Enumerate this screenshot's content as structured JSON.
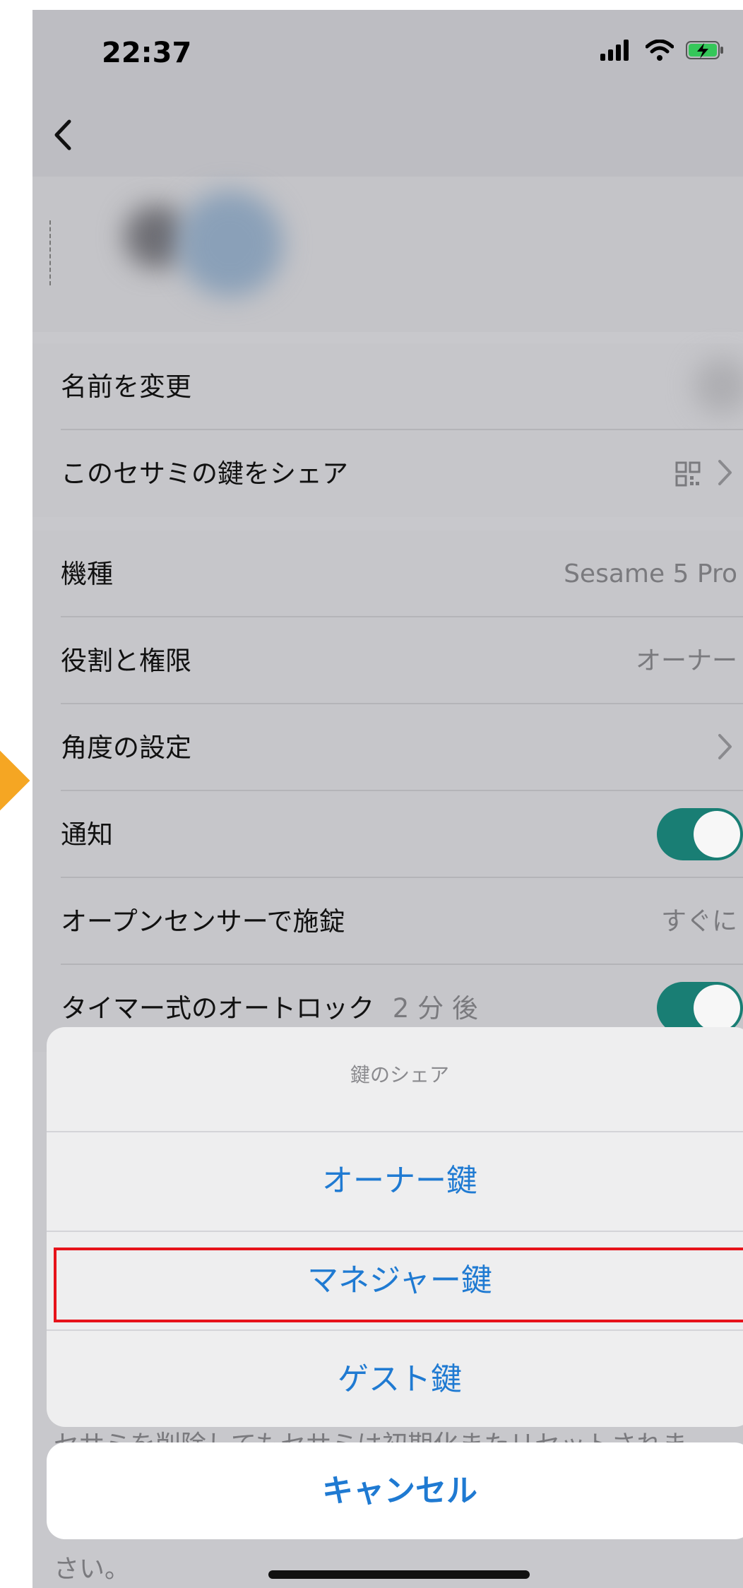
{
  "status_bar": {
    "time": "22:37",
    "icons": [
      "signal-icon",
      "wifi-icon",
      "battery-charging-icon"
    ]
  },
  "nav": {
    "back_icon": "chevron-left-icon"
  },
  "sections": {
    "group1": [
      {
        "label": "名前を変更"
      },
      {
        "label": "このセサミの鍵をシェア",
        "icon": "qr-code-icon"
      }
    ],
    "group2": [
      {
        "label": "機種",
        "value": "Sesame 5 Pro"
      },
      {
        "label": "役割と権限",
        "value": "オーナー"
      },
      {
        "label": "角度の設定",
        "icon": "chevron-right-icon"
      },
      {
        "label": "通知",
        "toggle": true
      },
      {
        "label": "オープンセンサーで施錠",
        "value": "すぐに"
      },
      {
        "label": "タイマー式のオートロック",
        "sublabel": "2 分 後",
        "toggle": true
      }
    ]
  },
  "action_sheet": {
    "title": "鍵のシェア",
    "options": [
      "オーナー鍵",
      "マネジャー鍵",
      "ゲスト鍵"
    ],
    "highlighted_index": 1,
    "cancel": "キャンセル"
  },
  "background_hint": {
    "line1": "セサミを削除してもセサミは初期化またリセットされま",
    "line2": "さい。"
  },
  "colors": {
    "accent_blue": "#1f7ad2",
    "toggle_green": "#197e74",
    "highlight_red": "#e6121a",
    "marker_orange": "#f5a623"
  }
}
